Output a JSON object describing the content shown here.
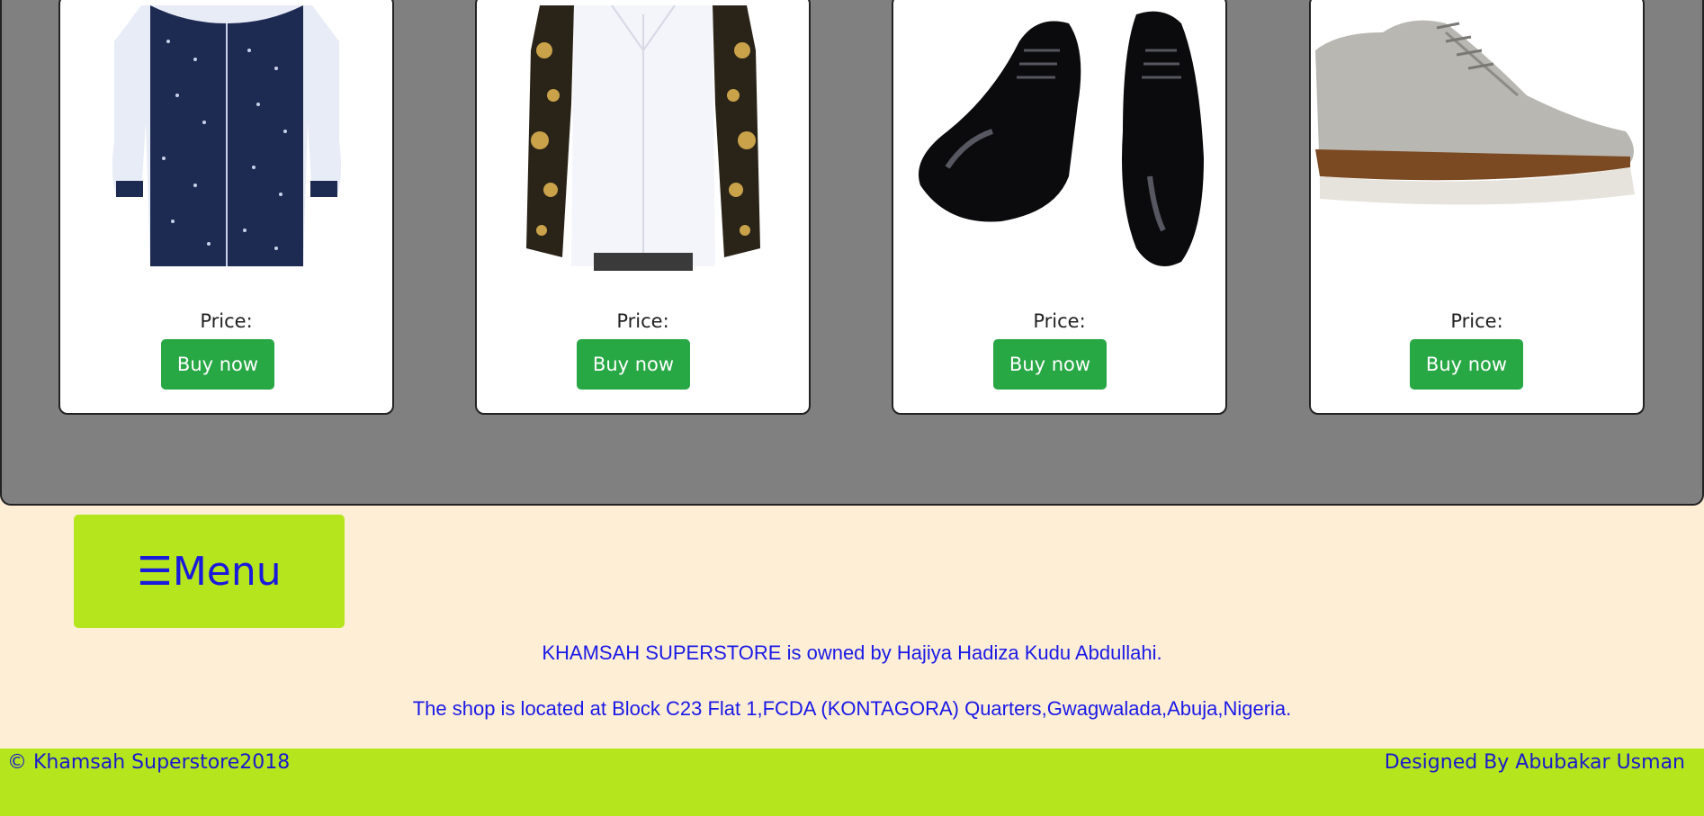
{
  "products": [
    {
      "image_label": "navy-dotted-shirt",
      "price_label": "Price:",
      "buy_label": "Buy now"
    },
    {
      "image_label": "floral-sleeve-shirt",
      "price_label": "Price:",
      "buy_label": "Buy now"
    },
    {
      "image_label": "black-patent-shoes",
      "price_label": "Price:",
      "buy_label": "Buy now"
    },
    {
      "image_label": "grey-canvas-shoe",
      "price_label": "Price:",
      "buy_label": "Buy now"
    }
  ],
  "menu": {
    "icon": "☰",
    "label": "Menu"
  },
  "info": {
    "owner_line": "KHAMSAH SUPERSTORE is owned by Hajiya Hadiza Kudu Abdullahi.",
    "location_line": "The shop is located at Block C23 Flat 1,FCDA (KONTAGORA) Quarters,Gwagwalada,Abuja,Nigeria."
  },
  "footer": {
    "copyright": "© Khamsah Superstore2018",
    "designer": "Designed By Abubakar Usman"
  },
  "colors": {
    "page_bg": "#ffeed6",
    "panel_bg": "#808080",
    "accent_green": "#b5e61d",
    "button_green": "#28a745",
    "text_blue": "#1a1ae6"
  }
}
